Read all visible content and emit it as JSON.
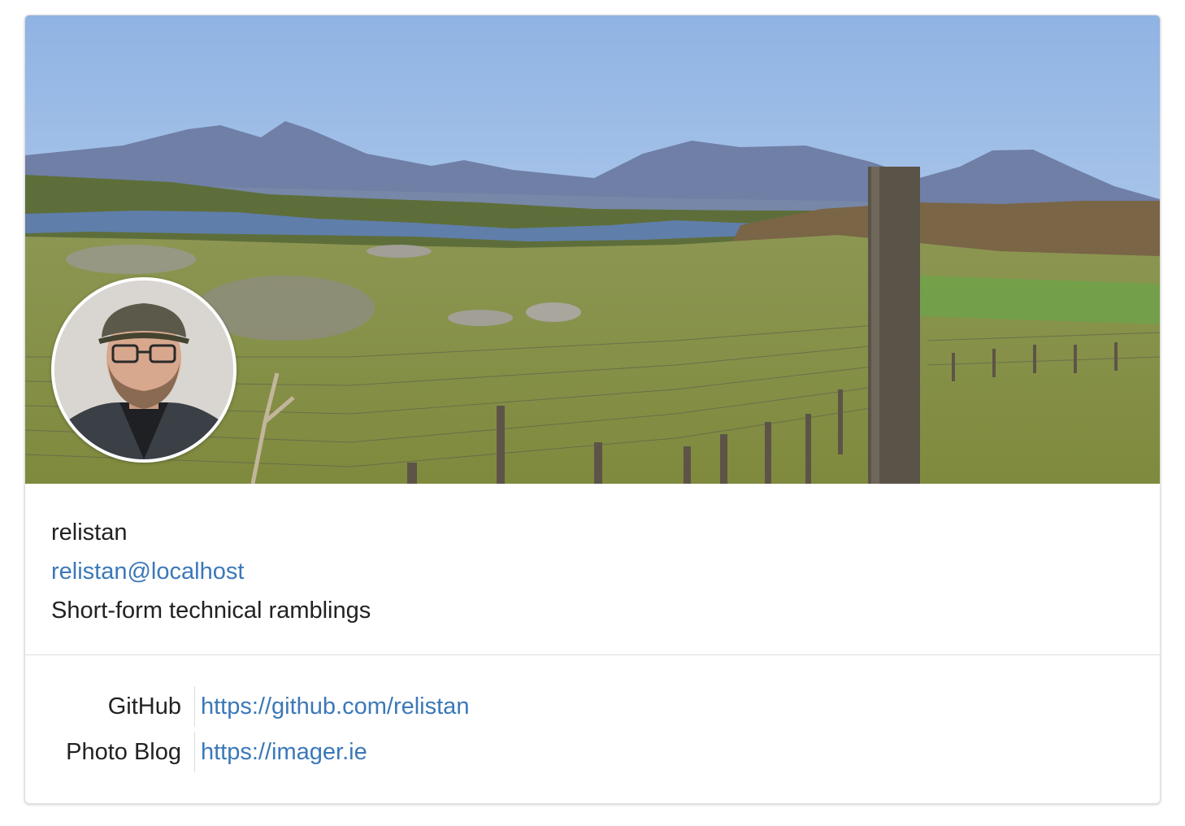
{
  "profile": {
    "username": "relistan",
    "handle": "relistan@localhost",
    "bio": "Short-form technical ramblings",
    "header_image": "landscape-photo",
    "avatar_image": "profile-photo"
  },
  "fields": [
    {
      "name": "GitHub",
      "value": "https://github.com/relistan"
    },
    {
      "name": "Photo Blog",
      "value": "https://imager.ie"
    }
  ],
  "colors": {
    "link": "#3b78b8",
    "text": "#222222",
    "divider": "#dddddd"
  }
}
